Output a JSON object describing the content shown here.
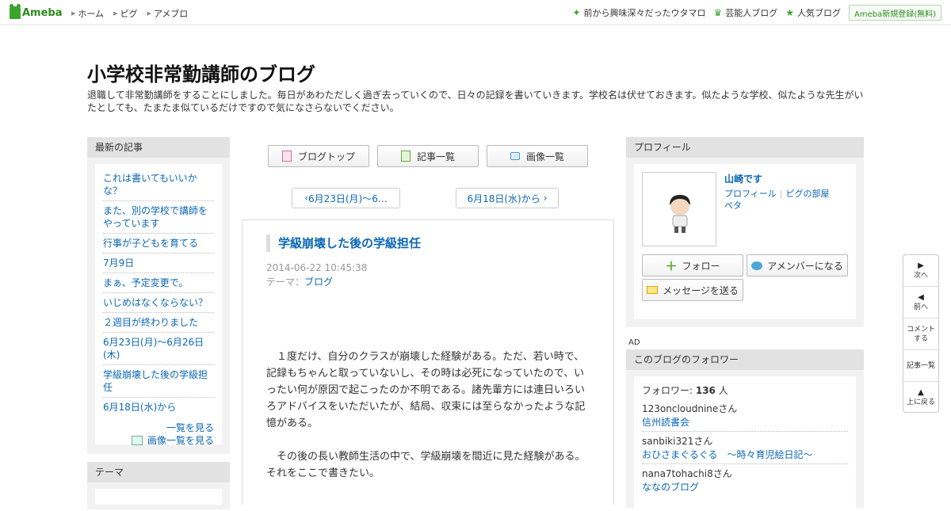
{
  "topbar": {
    "logo": "Ameba",
    "nav_left": [
      "ホーム",
      "ピグ",
      "アメブロ"
    ],
    "nav_right": [
      {
        "label": "前から興味深々だったウタマロ",
        "icon": "sparkle-icon"
      },
      {
        "label": "芸能人ブログ",
        "icon": "crown-icon"
      },
      {
        "label": "人気ブログ",
        "icon": "star-icon"
      }
    ],
    "register": "Ameba新規登録(無料)"
  },
  "blog": {
    "title": "小学校非常勤講師のブログ",
    "description": "退職して非常勤講師をすることにしました。毎日があわただしく過ぎ去っていくので、日々の記録を書いていきます。学校名は伏せておきます。似たような学校、似たような先生がいたとしても、たまたま似ているだけですので気になさらないでください。"
  },
  "left": {
    "recent_header": "最新の記事",
    "recent": [
      "これは書いてもいいかな？",
      "また、別の学校で講師をやっています",
      "行事が子どもを育てる",
      "7月9日",
      "まぁ、予定変更で。",
      "いじめはなくならない？",
      "２週目が終わりました",
      "6月23日(月)～6月26日(木)",
      "学級崩壊した後の学級担任",
      "6月18日(水)から"
    ],
    "list_more": "一覧を見る",
    "image_more": "画像一覧を見る",
    "theme_header": "テーマ"
  },
  "tabs": {
    "top": "ブログトップ",
    "list": "記事一覧",
    "images": "画像一覧"
  },
  "pager": {
    "prev": "6月23日(月)～6…",
    "next": "6月18日(水)から"
  },
  "article": {
    "title": "学級崩壊した後の学級担任",
    "date": "2014-06-22 10:45:38",
    "theme_label": "テーマ：",
    "theme": "ブログ",
    "paragraphs": [
      "１度だけ、自分のクラスが崩壊した経験がある。ただ、若い時で、記録もちゃんと取っていないし、その時は必死になっていたので、いったい何が原因で起こったのか不明である。諸先輩方には連日いろいろアドバイスをいただいたが、結局、収束には至らなかったような記憶がある。",
      "その後の長い教師生活の中で、学級崩壊を間近に見た経験がある。それをここで書きたい。"
    ]
  },
  "profile": {
    "header": "プロフィール",
    "name": "山崎です",
    "link_profile": "プロフィール",
    "link_pig": "ピグの部屋",
    "link_peta": "ペタ",
    "follow": "フォロー",
    "amember": "アメンバーになる",
    "message": "メッセージを送る"
  },
  "ad_label": "AD",
  "followers": {
    "header": "このブログのフォロワー",
    "count_label": "フォロワー: ",
    "count": "136",
    "count_unit": " 人",
    "items": [
      {
        "user": "123oncloudnineさん",
        "blog": "信州読書会"
      },
      {
        "user": "sanbiki321さん",
        "blog": "おひさまぐるぐる　～時々育児絵日記～"
      },
      {
        "user": "nana7tohachi8さん",
        "blog": "ななのブログ"
      }
    ]
  },
  "floatnav": {
    "next": "次へ",
    "prev": "前へ",
    "comment1": "コメント",
    "comment2": "する",
    "list": "記事一覧",
    "top": "上に戻る"
  }
}
